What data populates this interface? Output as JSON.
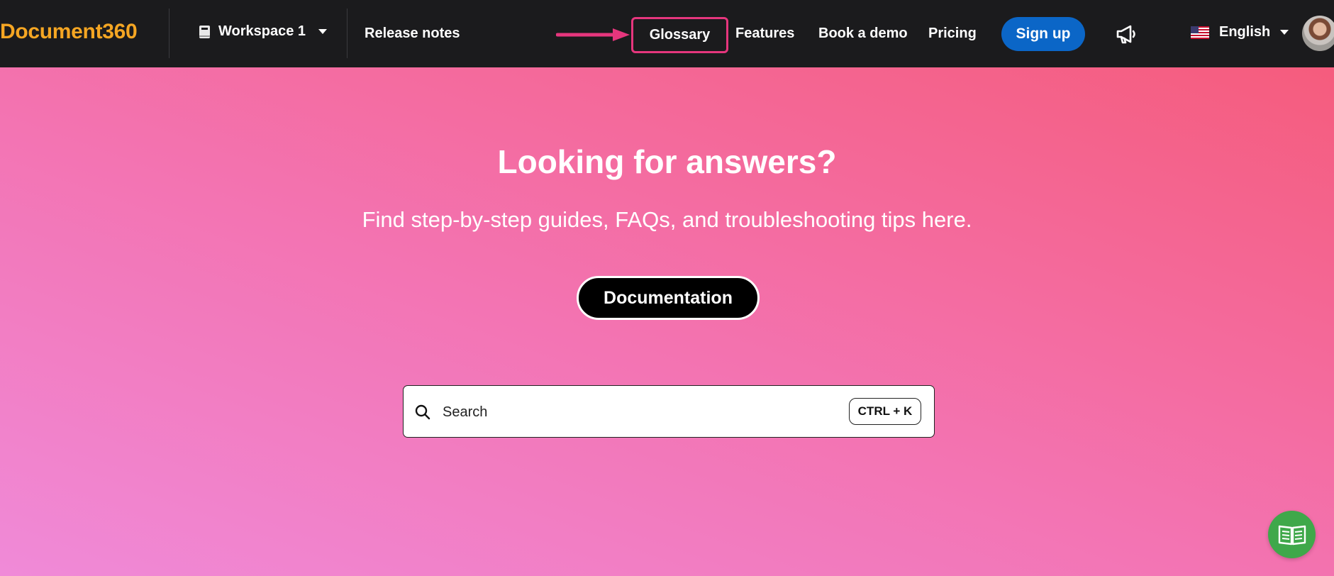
{
  "header": {
    "logo": "Document360",
    "workspace": "Workspace 1",
    "release_notes": "Release notes",
    "nav": {
      "glossary": "Glossary",
      "features": "Features",
      "book_demo": "Book a demo",
      "pricing": "Pricing"
    },
    "signup": "Sign up",
    "language": "English"
  },
  "hero": {
    "title": "Looking for answers?",
    "subtitle": "Find step-by-step guides, FAQs, and troubleshooting tips here.",
    "documentation_button": "Documentation"
  },
  "search": {
    "placeholder": "Search",
    "shortcut": "CTRL + K"
  },
  "colors": {
    "logo": "#f5a623",
    "topbar": "#1b1b1d",
    "signup": "#0b66c7",
    "highlight": "#e6367d",
    "fab": "#3fa84a"
  },
  "icons": [
    "book-icon",
    "chevron-down-icon",
    "arrow-right-icon",
    "megaphone-icon",
    "us-flag-icon",
    "search-icon",
    "open-book-icon"
  ]
}
